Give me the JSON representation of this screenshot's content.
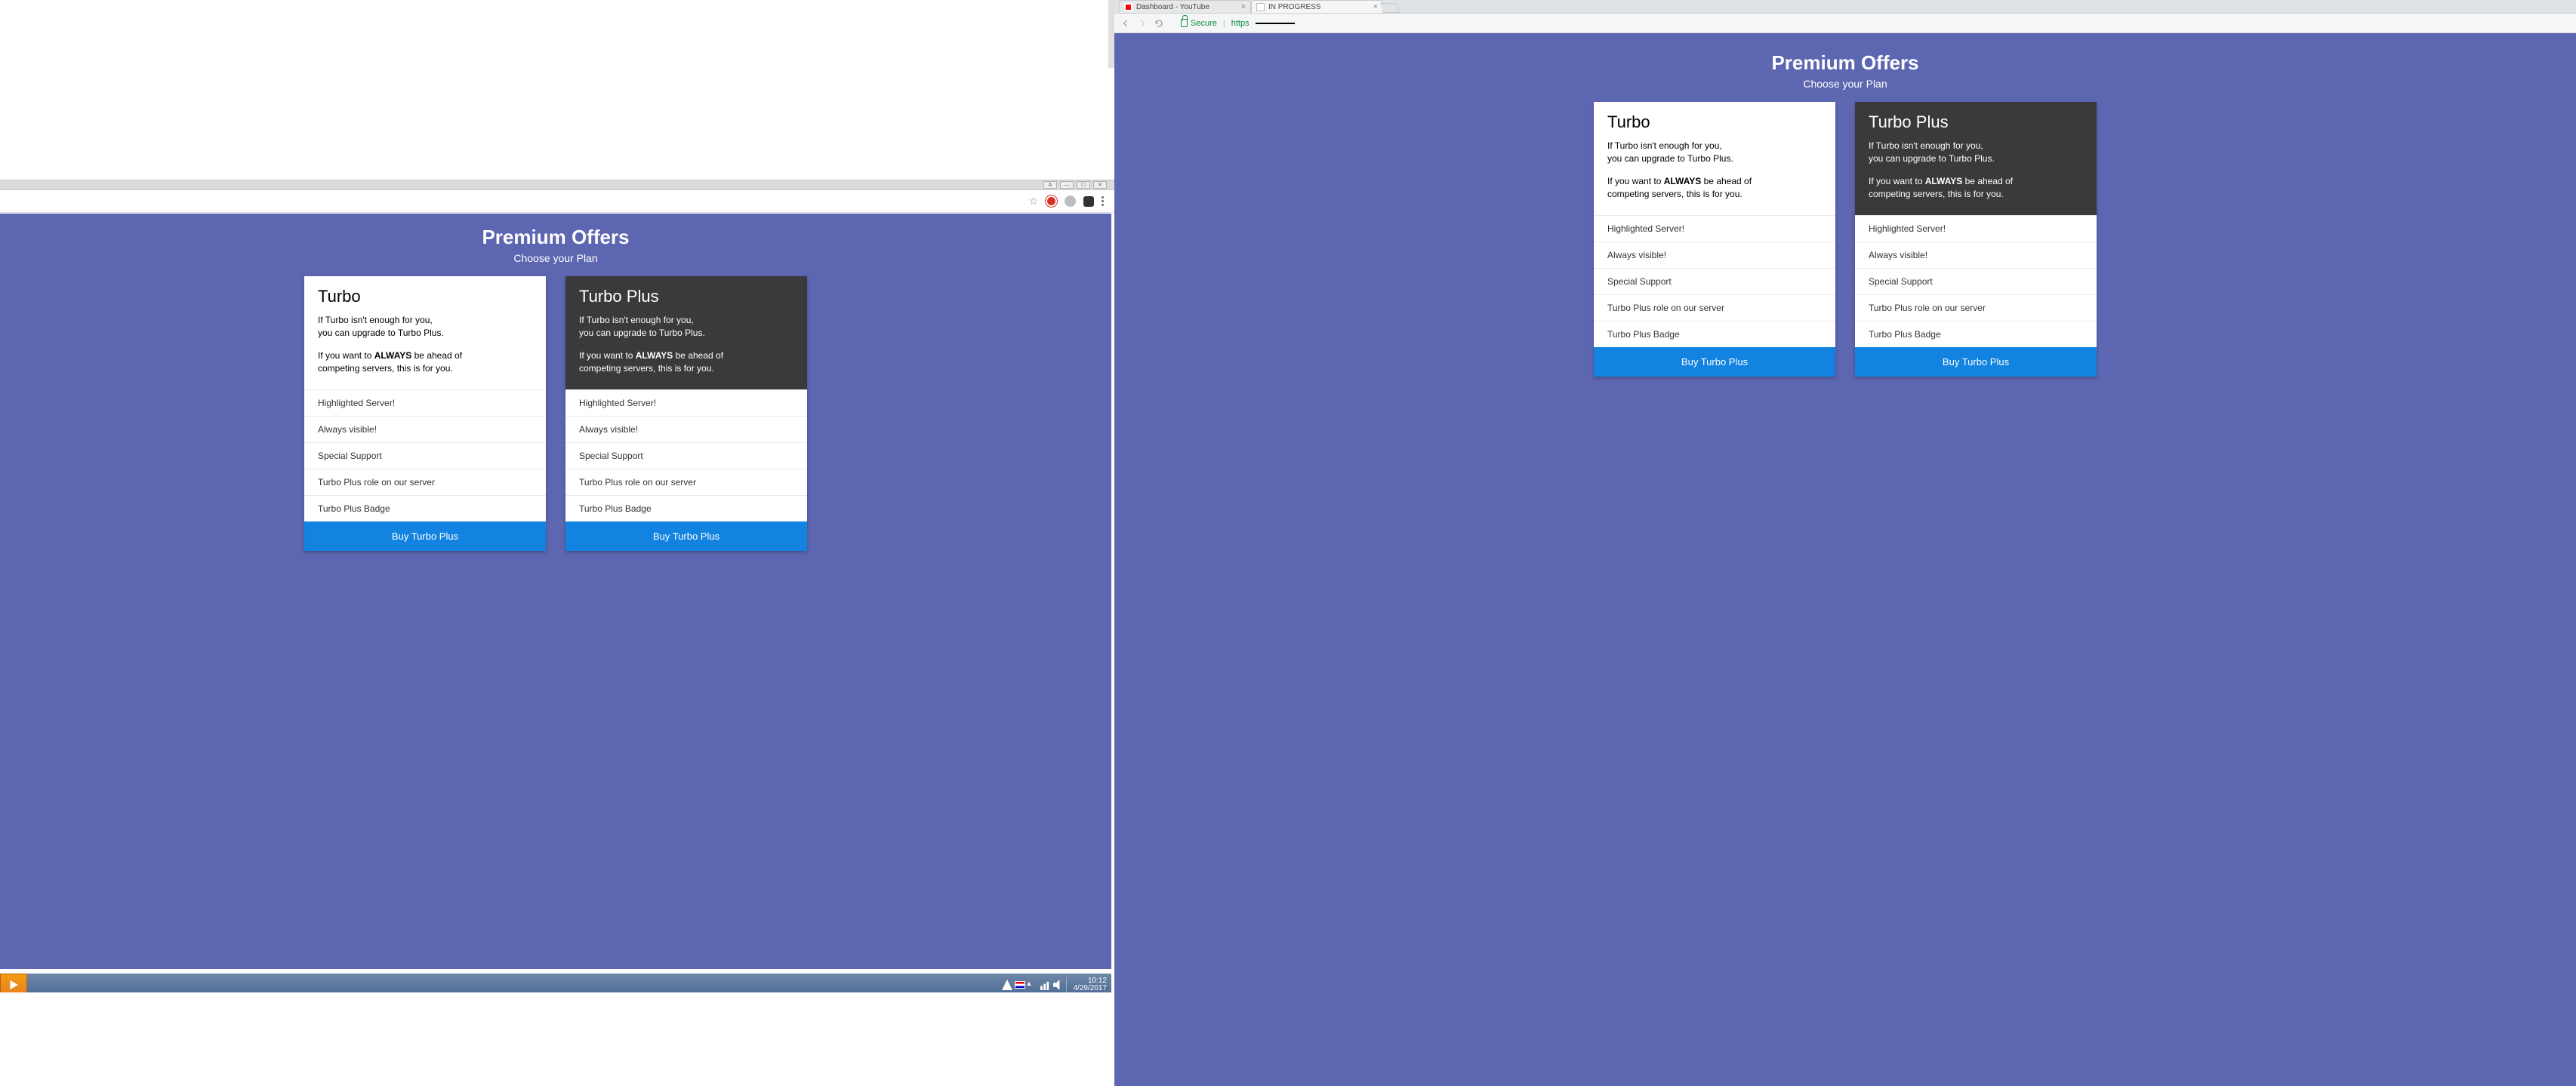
{
  "right_browser": {
    "tabs": [
      {
        "label": "Dashboard - YouTube",
        "favicon": "yt"
      },
      {
        "label": "IN PROGRESS",
        "favicon": "doc"
      }
    ],
    "nav": {
      "secure_label": "Secure",
      "url_scheme": "https"
    }
  },
  "taskbar": {
    "time": "10:12",
    "date": "4/29/2017"
  },
  "premium": {
    "title": "Premium Offers",
    "subtitle": "Choose your Plan",
    "cards": [
      {
        "title": "Turbo",
        "variant": "light",
        "line1": "If Turbo isn't enough for you,",
        "line2": "you can upgrade to Turbo Plus.",
        "line3a": "If you want to ",
        "line3b": "ALWAYS",
        "line3c": " be ahead of",
        "line4": "competing servers, this is for you.",
        "features": [
          "Highlighted Server!",
          "Always visible!",
          "Special Support",
          "Turbo Plus role on our server",
          "Turbo Plus Badge"
        ],
        "buy_label": "Buy Turbo Plus"
      },
      {
        "title": "Turbo Plus",
        "variant": "dark",
        "line1": "If Turbo isn't enough for you,",
        "line2": "you can upgrade to Turbo Plus.",
        "line3a": "If you want to ",
        "line3b": "ALWAYS",
        "line3c": " be ahead of",
        "line4": "competing servers, this is for you.",
        "features": [
          "Highlighted Server!",
          "Always visible!",
          "Special Support",
          "Turbo Plus role on our server",
          "Turbo Plus Badge"
        ],
        "buy_label": "Buy Turbo Plus"
      }
    ]
  }
}
